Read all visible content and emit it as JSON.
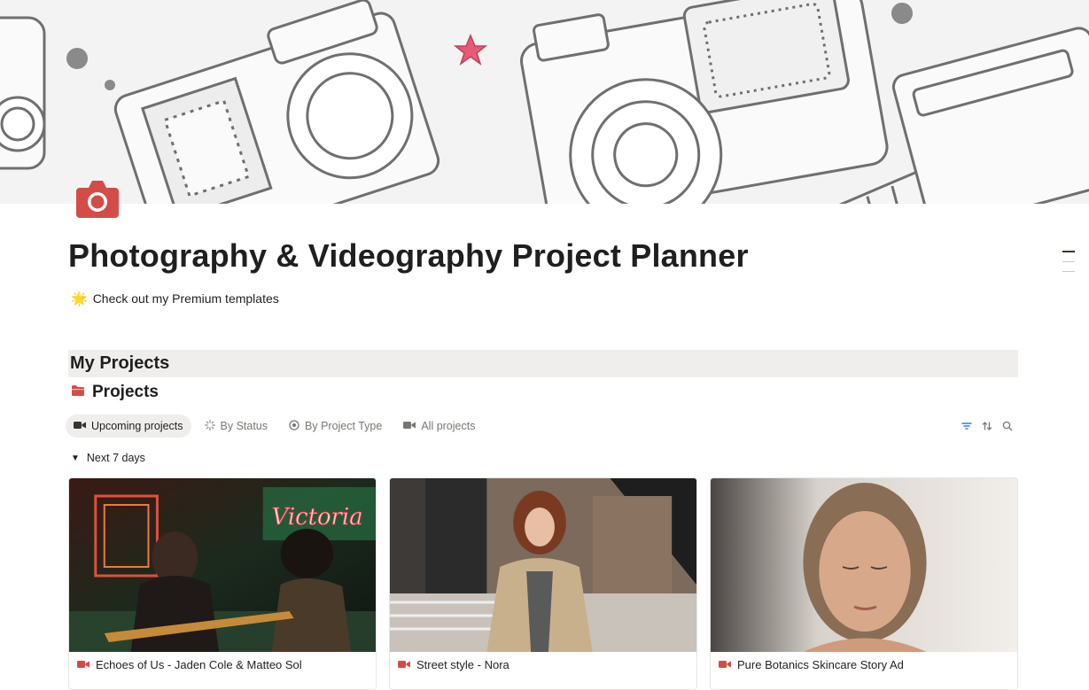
{
  "page": {
    "title": "Photography & Videography Project Planner",
    "callout_icon": "sparkle-star",
    "callout_text": "Check out my Premium templates"
  },
  "section": {
    "heading": "My Projects"
  },
  "database": {
    "icon": "folder-icon",
    "title": "Projects",
    "views": [
      {
        "label": "Upcoming projects",
        "icon": "video-camera-icon",
        "active": true
      },
      {
        "label": "By Status",
        "icon": "loading-spinner-icon",
        "active": false
      },
      {
        "label": "By Project Type",
        "icon": "radio-circle-icon",
        "active": false
      },
      {
        "label": "All projects",
        "icon": "video-camera-icon",
        "active": false
      }
    ],
    "tools": [
      "filter-icon",
      "sort-icon",
      "search-icon"
    ],
    "group_label": "Next 7 days",
    "cards": [
      {
        "title": "Echoes of Us - Jaden Cole & Matteo Sol",
        "icon": "video-camera-icon"
      },
      {
        "title": "Street style - Nora",
        "icon": "video-camera-icon"
      },
      {
        "title": "Pure Botanics Skincare Story Ad",
        "icon": "video-camera-icon"
      }
    ]
  },
  "colors": {
    "accent_red": "#d44c47",
    "heading_bg": "#efeeec",
    "muted_text": "#787774"
  }
}
